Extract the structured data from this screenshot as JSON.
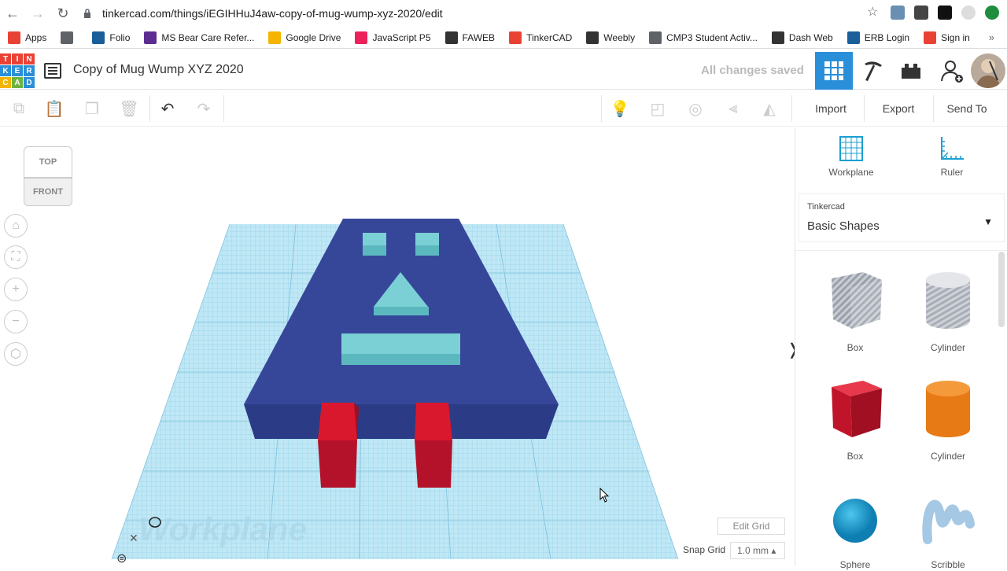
{
  "browser": {
    "url": "tinkercad.com/things/iEGIHHuJ4aw-copy-of-mug-wump-xyz-2020/edit",
    "bookmarks": [
      {
        "label": "Apps",
        "color": "#e94235"
      },
      {
        "label": "",
        "color": "#5f6368"
      },
      {
        "label": "Folio",
        "color": "#1a5e9a"
      },
      {
        "label": "MS Bear Care Refer...",
        "color": "#5c2d91"
      },
      {
        "label": "Google Drive",
        "color": "#f4b400"
      },
      {
        "label": "JavaScript P5",
        "color": "#ed225d"
      },
      {
        "label": "FAWEB",
        "color": "#333333"
      },
      {
        "label": "TinkerCAD",
        "color": "#e94235"
      },
      {
        "label": "Weebly",
        "color": "#333333"
      },
      {
        "label": "CMP3 Student Activ...",
        "color": "#5f6368"
      },
      {
        "label": "Dash Web",
        "color": "#333333"
      },
      {
        "label": "ERB Login",
        "color": "#1a5e9a"
      },
      {
        "label": "Sign in",
        "color": "#e94235"
      }
    ],
    "more": "»"
  },
  "header": {
    "logo_letters": [
      "T",
      "I",
      "N",
      "K",
      "E",
      "R",
      "C",
      "A",
      "D"
    ],
    "logo_colors": [
      "#e94235",
      "#e94235",
      "#e94235",
      "#2a8fd9",
      "#2a8fd9",
      "#2a8fd9",
      "#f4b400",
      "#6cb33f",
      "#2a8fd9"
    ],
    "title": "Copy of Mug Wump XYZ 2020",
    "save_status": "All changes saved"
  },
  "toolbar": {
    "import": "Import",
    "export": "Export",
    "send_to": "Send To"
  },
  "viewport": {
    "cube_top": "TOP",
    "cube_front": "FRONT",
    "workplane_text": "Workplane",
    "edit_grid": "Edit Grid",
    "snap_grid_label": "Snap Grid",
    "snap_grid_value": "1.0 mm ▴"
  },
  "panel": {
    "workplane": "Workplane",
    "ruler": "Ruler",
    "category_small": "Tinkercad",
    "category": "Basic Shapes",
    "shapes": [
      {
        "label": "Box",
        "kind": "box-hole",
        "color": "#b8bcc4"
      },
      {
        "label": "Cylinder",
        "kind": "cyl-hole",
        "color": "#b8bcc4"
      },
      {
        "label": "Box",
        "kind": "box",
        "color": "#d9182d"
      },
      {
        "label": "Cylinder",
        "kind": "cyl",
        "color": "#e87a16"
      },
      {
        "label": "Sphere",
        "kind": "sphere",
        "color": "#1a9fd0"
      },
      {
        "label": "Scribble",
        "kind": "scribble",
        "color": "#a5c8e4"
      }
    ]
  },
  "colors": {
    "accent": "#2a8fd9",
    "plate": "#36479a",
    "features": "#7ad0d4",
    "legs": "#d9182d",
    "workplane": "#a9dff0"
  }
}
